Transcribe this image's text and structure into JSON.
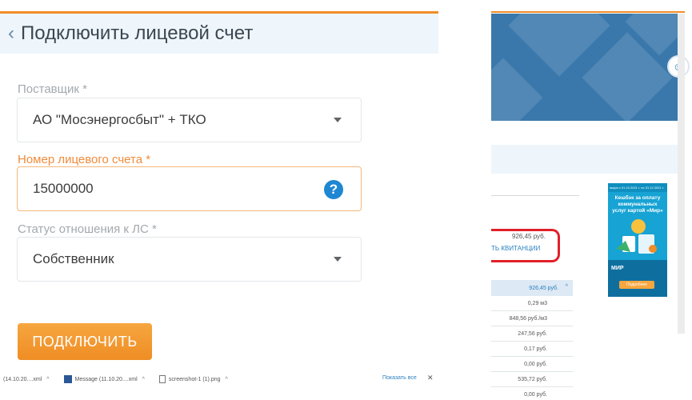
{
  "modal": {
    "title": "Подключить лицевой счет",
    "back_icon": "chevron-left-icon",
    "fields": [
      {
        "label": "Поставщик *",
        "value": "АО \"Мосэнергосбыт\" + ТКО",
        "type": "select"
      },
      {
        "label": "Номер лицевого счета *",
        "value": "15000000",
        "type": "text",
        "help_icon": "?"
      },
      {
        "label": "Статус отношения к ЛС *",
        "value": "Собственник",
        "type": "select"
      }
    ],
    "connect_label": "ПОДКЛЮЧИТЬ",
    "accent_color": "#f28c28",
    "button_color": "#ef8d24",
    "help_color": "#1f87d2"
  },
  "downloads": {
    "items": [
      {
        "name": "(14.10.20....xml"
      },
      {
        "name": "Message (11.10.20....xml"
      },
      {
        "name": "screenshot-1 (1).png"
      }
    ],
    "show_all": "Показать все",
    "close": "✕"
  },
  "background_page": {
    "receipt_amount": "926,45 руб.",
    "receipt_link": "ТЬ КВИТАНЦИИ",
    "table_header": "926,45 руб.",
    "rows": [
      "0,29 м3",
      "848,56 руб./м3",
      "247,56 руб.",
      "0,17 руб.",
      "0,00 руб.",
      "535,72 руб.",
      "0,00 руб."
    ],
    "ad": {
      "top": "акция с 01.10.2021 г. по 31.12.2021 г.",
      "title": "Кешбэк за оплату коммунальных услуг картой «Мир»",
      "logo": "МИР",
      "button": "Подробнее"
    }
  }
}
